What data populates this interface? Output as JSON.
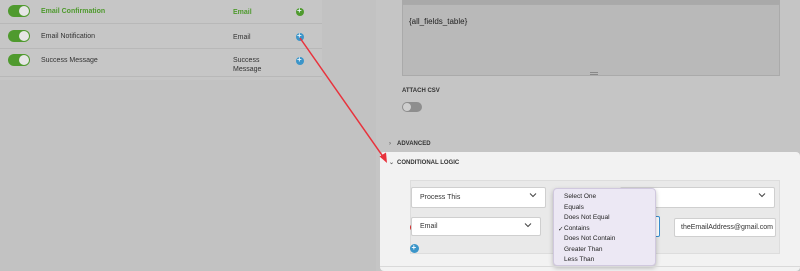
{
  "notifications": [
    {
      "name": "Email Confirmation",
      "type": "Email",
      "enabled": true,
      "active": true
    },
    {
      "name": "Email Notification",
      "type": "Email",
      "enabled": true,
      "active": false
    },
    {
      "name": "Success Message",
      "type_line1": "Success",
      "type_line2": "Message",
      "enabled": true,
      "active": false
    }
  ],
  "editor": {
    "content": "{all_fields_table}"
  },
  "attach_csv": {
    "label": "ATTACH CSV",
    "enabled": false
  },
  "advanced": {
    "label": "ADVANCED",
    "chevron": "chevron-right-icon"
  },
  "conditional_logic": {
    "label": "CONDITIONAL LOGIC",
    "chevron": "chevron-down-icon",
    "process_select": "Process This",
    "field_select": "Email",
    "value_input": "theEmailAddress@gmail.com",
    "operator_selected": "Contains",
    "operator_options": [
      "Select One",
      "Equals",
      "Does Not Equal",
      "Contains",
      "Does Not Contain",
      "Greater Than",
      "Less Than"
    ]
  },
  "colors": {
    "accent_green": "#4f9a2e",
    "accent_blue": "#3b95c9",
    "remove_red": "#d12a2a",
    "annotation_arrow": "#e8323c"
  }
}
